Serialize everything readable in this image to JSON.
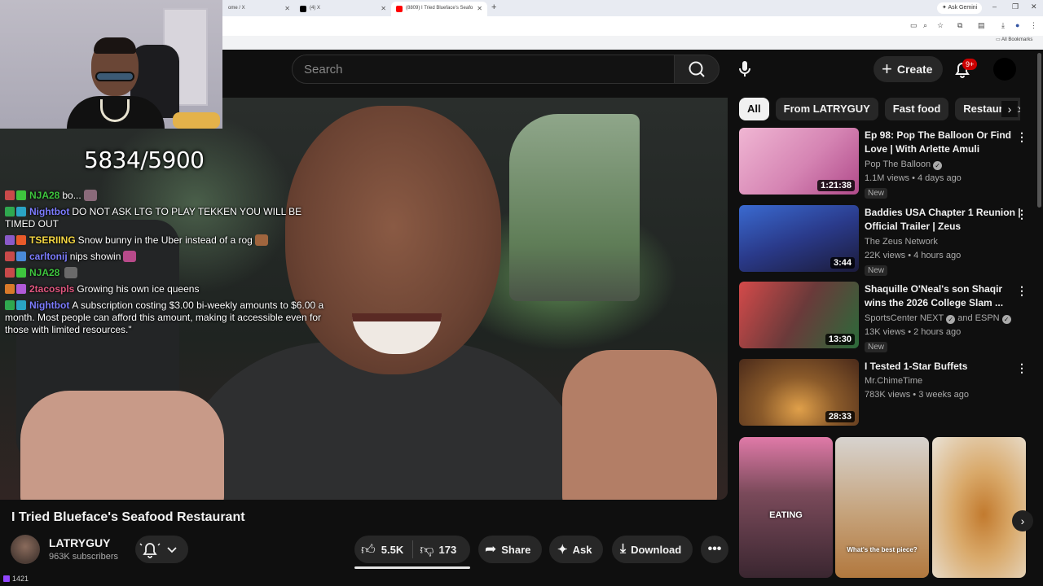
{
  "browser": {
    "tabs": [
      {
        "label": "ome / X",
        "fav": "#9aa0a6"
      },
      {
        "label": "(4) X",
        "fav": "#000000"
      },
      {
        "label": "(8809) I Tried Blueface's Seafo",
        "fav": "#ff0000"
      }
    ],
    "ask_gemini": "Ask Gemini",
    "bookmarks_label": "All Bookmarks"
  },
  "header": {
    "search_placeholder": "Search",
    "create_label": "Create",
    "notif_count": "9+"
  },
  "stream": {
    "goal_text": "5834/5900",
    "viewer_count": "1421",
    "chat": [
      {
        "user": "NJA28",
        "color": "#3ec43e",
        "text": "bo..."
      },
      {
        "user": "Nightbot",
        "color": "#7c7cff",
        "text": "DO NOT ASK LTG TO PLAY TEKKEN YOU WILL BE TIMED OUT"
      },
      {
        "user": "TSERIING",
        "color": "#f5d742",
        "text": "Snow bunny in the Uber instead of a rog"
      },
      {
        "user": "carltonij",
        "color": "#7c7cff",
        "text": "nips showin"
      },
      {
        "user": "NJA28",
        "color": "#3ec43e",
        "text": ""
      },
      {
        "user": "2tacospls",
        "color": "#e0567f",
        "text": "Growing his own ice queens"
      },
      {
        "user": "Nightbot",
        "color": "#7c7cff",
        "text": "A subscription costing $3.00 bi-weekly amounts to $6.00 a month. Most people can afford this amount, making it accessible even for those with limited resources.\""
      }
    ]
  },
  "video": {
    "title": "I Tried Blueface's Seafood Restaurant",
    "channel": "LATRYGUY",
    "subscribers": "963K subscribers",
    "likes": "5.5K",
    "dislikes": "173",
    "share_label": "Share",
    "ask_label": "Ask",
    "download_label": "Download"
  },
  "sidebar": {
    "chips": [
      "All",
      "From LATRYGUY",
      "Fast food",
      "Restaurants"
    ],
    "recommendations": [
      {
        "title": "Ep 98: Pop The Balloon Or Find Love | With Arlette Amuli",
        "channel": "Pop The Balloon",
        "verified": true,
        "meta": "1.1M views • 4 days ago",
        "new": "New",
        "duration": "1:21:38",
        "thumb_a": "#f0b6d3",
        "thumb_b": "#b04a8a"
      },
      {
        "title": "Baddies USA Chapter 1 Reunion | Official Trailer | Zeus",
        "channel": "The Zeus Network",
        "verified": false,
        "meta": "22K views • 4 hours ago",
        "new": "New",
        "duration": "3:44",
        "thumb_a": "#3a6ad0",
        "thumb_b": "#1b1b3a"
      },
      {
        "title": "Shaquille O'Neal's son Shaqir wins the 2026 College Slam ...",
        "channel": "SportsCenter NEXT",
        "channel_extra": "and ESPN",
        "verified": true,
        "meta": "13K views • 2 hours ago",
        "new": "New",
        "duration": "13:30",
        "thumb_a": "#d44a4a",
        "thumb_b": "#2b6b3a"
      },
      {
        "title": "I Tested 1-Star Buffets",
        "channel": "Mr.ChimeTime",
        "verified": false,
        "meta": "783K views • 3 weeks ago",
        "new": "",
        "duration": "28:33",
        "thumb_a": "#e08a2a",
        "thumb_b": "#4a2a1a"
      }
    ],
    "shorts": [
      {
        "caption": "EATING",
        "a": "#e07aa8",
        "b": "#3a2630"
      },
      {
        "caption": "What's the best piece?",
        "a": "#d7d3cf",
        "b": "#b2783e"
      },
      {
        "caption": "",
        "a": "#e9e2d6",
        "b": "#c27a2e"
      }
    ]
  }
}
